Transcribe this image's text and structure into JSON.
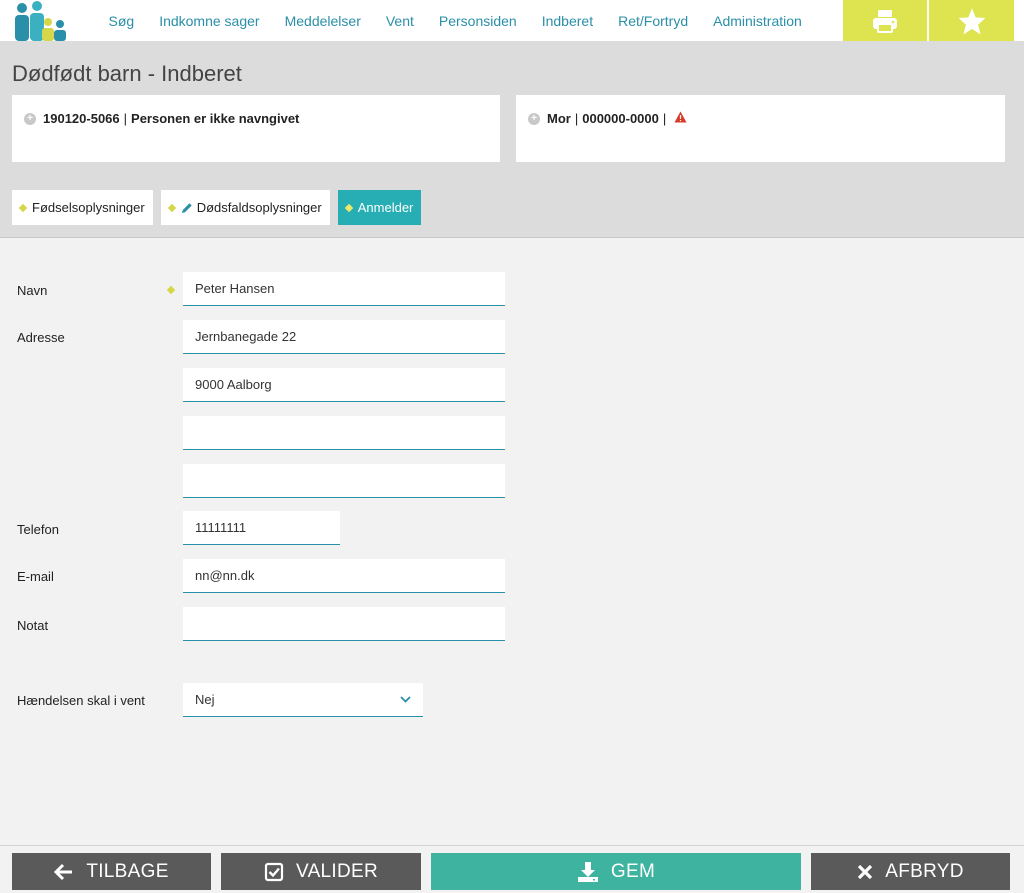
{
  "nav": {
    "items": [
      "Søg",
      "Indkomne sager",
      "Meddelelser",
      "Vent",
      "Personsiden",
      "Indberet",
      "Ret/Fortryd",
      "Administration"
    ],
    "print_icon": "print-icon",
    "star_icon": "star-icon",
    "accent": "#dde44f"
  },
  "page": {
    "title": "Dødfødt barn - Indberet"
  },
  "cards": {
    "child": {
      "id": "190120-5066",
      "text": "Personen er ikke navngivet"
    },
    "mother": {
      "role": "Mor",
      "id": "000000-0000",
      "warning_icon": "warning-icon"
    }
  },
  "tabs": [
    {
      "label": "Fødselsoplysninger",
      "active": false
    },
    {
      "label": "Dødsfaldsoplysninger",
      "active": false
    },
    {
      "label": "Anmelder",
      "active": true
    }
  ],
  "form": {
    "name_label": "Navn",
    "name_value": "Peter Hansen",
    "address_label": "Adresse",
    "address_lines": [
      "Jernbanegade 22",
      "9000 Aalborg",
      "",
      ""
    ],
    "phone_label": "Telefon",
    "phone_value": "11111111",
    "email_label": "E-mail",
    "email_value": "nn@nn.dk",
    "note_label": "Notat",
    "note_value": "",
    "wait_label": "Hændelsen skal i vent",
    "wait_value": "Nej"
  },
  "footer": {
    "back": "TILBAGE",
    "validate": "VALIDER",
    "save": "GEM",
    "cancel": "AFBRYD",
    "save_color": "#3db3a0",
    "dark_color": "#5a5a5a"
  }
}
